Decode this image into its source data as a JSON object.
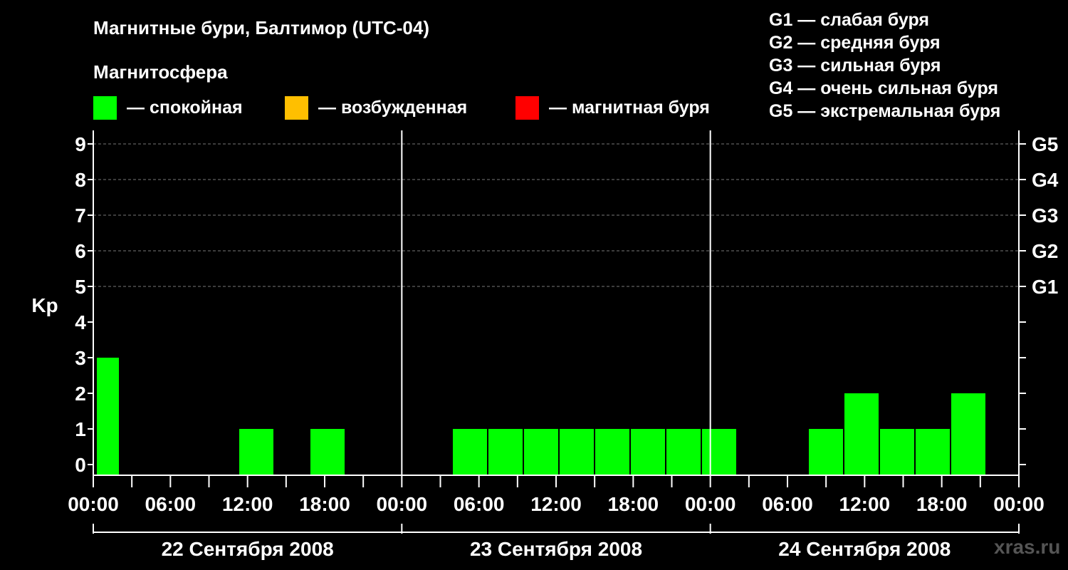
{
  "title": "Магнитные бури, Балтимор (UTC-04)",
  "subtitle": "Магнитосфера",
  "legend": [
    {
      "color": "#00ff00",
      "label": "— спокойная"
    },
    {
      "color": "#ffbf00",
      "label": "— возбужденная"
    },
    {
      "color": "#ff0000",
      "label": "— магнитная буря"
    }
  ],
  "storm_scale": [
    "G1 — слабая буря",
    "G2 — средняя буря",
    "G3 — сильная буря",
    "G4 — очень сильная буря",
    "G5 — экстремальная буря"
  ],
  "watermark": "xras.ru",
  "chart_data": {
    "type": "bar",
    "ylabel": "Kp",
    "ylim": [
      0,
      9
    ],
    "yticks": [
      "0",
      "1",
      "2",
      "3",
      "4",
      "5",
      "6",
      "7",
      "8",
      "9"
    ],
    "right_ticks": [
      {
        "kp": 5,
        "label": "G1"
      },
      {
        "kp": 6,
        "label": "G2"
      },
      {
        "kp": 7,
        "label": "G3"
      },
      {
        "kp": 8,
        "label": "G4"
      },
      {
        "kp": 9,
        "label": "G5"
      }
    ],
    "grid": "dashed horizontal at Kp 5–9",
    "xtick_labels": [
      "00:00",
      "06:00",
      "12:00",
      "18:00",
      "00:00",
      "06:00",
      "12:00",
      "18:00",
      "00:00",
      "06:00",
      "12:00",
      "18:00",
      "00:00"
    ],
    "days": [
      "22 Сентября 2008",
      "23 Сентября 2008",
      "24 Сентября 2008"
    ],
    "interval_hours": 3,
    "bar_color": "#00ff00",
    "values": [
      3,
      0,
      0,
      0,
      1,
      0,
      1,
      0,
      0,
      0,
      1,
      1,
      1,
      1,
      1,
      1,
      1,
      1,
      0,
      0,
      1,
      2,
      1,
      1,
      2,
      0
    ]
  }
}
